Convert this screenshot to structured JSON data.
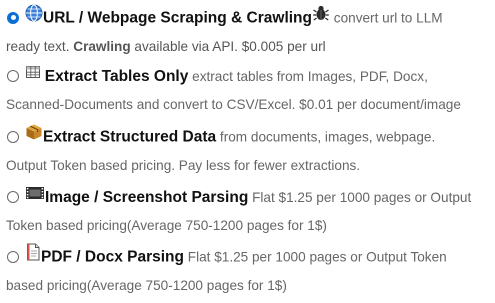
{
  "options": [
    {
      "selected": true,
      "icons": [
        "globe-icon",
        "bug-icon"
      ],
      "title": "URL / Webpage Scraping & Crawling",
      "desc_part1": "convert url to LLM",
      "desc_line2_prefix": "ready text. ",
      "desc_bold": "Crawling",
      "desc_line2_suffix": " available via API. $0.005 per url"
    },
    {
      "selected": false,
      "icons": [
        "table-icon"
      ],
      "title": "Extract Tables Only",
      "desc_part1": "extract tables from Images, PDF, Docx,",
      "desc_line2": "Scanned-Documents and convert to CSV/Excel. $0.01 per document/image"
    },
    {
      "selected": false,
      "icons": [
        "package-icon"
      ],
      "title": "Extract Structured Data",
      "desc_part1": "from documents, images, webpage.",
      "desc_line2": "Output Token based pricing. Pay less for fewer extractions."
    },
    {
      "selected": false,
      "icons": [
        "film-icon"
      ],
      "title": "Image / Screenshot Parsing",
      "desc_part1": "Flat $1.25 per 1000 pages or Output",
      "desc_line2": "Token based pricing(Average 750-1200 pages for 1$)"
    },
    {
      "selected": false,
      "icons": [
        "document-icon"
      ],
      "title": "PDF / Docx Parsing",
      "desc_part1": "Flat $1.25 per 1000 pages or Output Token",
      "desc_line2": "based pricing(Average 750-1200 pages for 1$)"
    }
  ]
}
